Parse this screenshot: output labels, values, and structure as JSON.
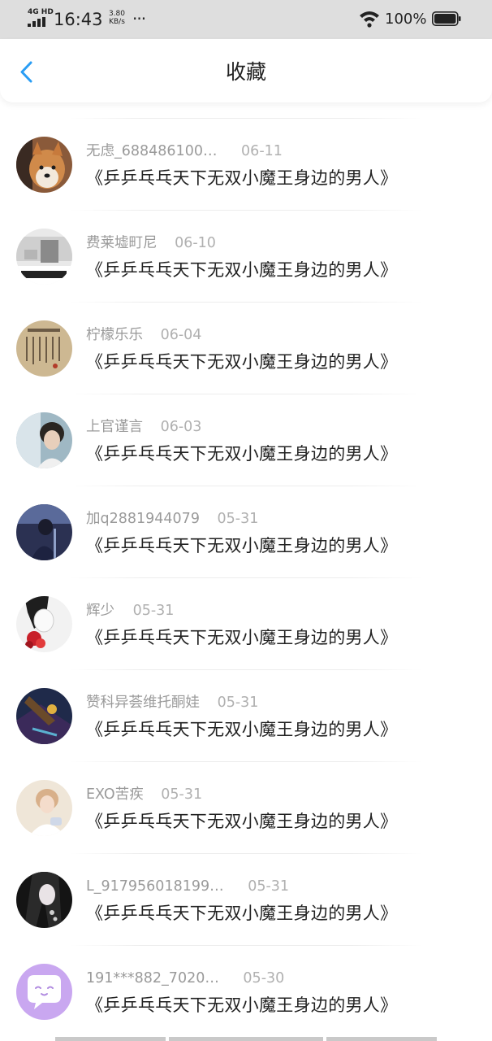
{
  "status_bar": {
    "network": "4G HD",
    "time": "16:43",
    "speed_value": "3.80",
    "speed_unit": "KB/s",
    "more": "···",
    "battery_pct": "100%",
    "icons": [
      "signal-icon",
      "wifi-icon",
      "battery-icon"
    ]
  },
  "header": {
    "title": "收藏",
    "back_icon": "chevron-left-icon",
    "accent_color": "#2a9df4"
  },
  "favorites": [
    {
      "name": "无虑_688486100…",
      "date": "06-11",
      "title": "《乒乒乓乓天下无双小魔王身边的男人》",
      "avatar": "shiba-dog"
    },
    {
      "name": "费莱墟町尼",
      "date": "06-10",
      "title": "《乒乒乓乓天下无双小魔王身边的男人》",
      "avatar": "monochrome-photo"
    },
    {
      "name": "柠檬乐乐",
      "date": "06-04",
      "title": "《乒乒乓乓天下无双小魔王身边的男人》",
      "avatar": "calligraphy"
    },
    {
      "name": "上官谨言",
      "date": "06-03",
      "title": "《乒乒乓乓天下无双小魔王身边的男人》",
      "avatar": "portrait"
    },
    {
      "name": "加q2881944079",
      "date": "05-31",
      "title": "《乒乒乓乓天下无双小魔王身边的男人》",
      "avatar": "blue-figure"
    },
    {
      "name": "辉少",
      "date": "05-31",
      "title": "《乒乒乓乓天下无双小魔王身边的男人》",
      "avatar": "anime-red-flower"
    },
    {
      "name": "赞科异荟维托酮娃",
      "date": "05-31",
      "title": "《乒乒乓乓天下无双小魔王身边的男人》",
      "avatar": "fantasy-art"
    },
    {
      "name": "EXO苦疾",
      "date": "05-31",
      "title": "《乒乒乓乓天下无双小魔王身边的男人》",
      "avatar": "idol-photo"
    },
    {
      "name": "L_917956018199…",
      "date": "05-31",
      "title": "《乒乒乓乓天下无双小魔王身边的男人》",
      "avatar": "anime-dark-hair"
    },
    {
      "name": "191***882_7020…",
      "date": "05-30",
      "title": "《乒乒乓乓天下无双小魔王身边的男人》",
      "avatar": "default-chat-bubble"
    }
  ]
}
